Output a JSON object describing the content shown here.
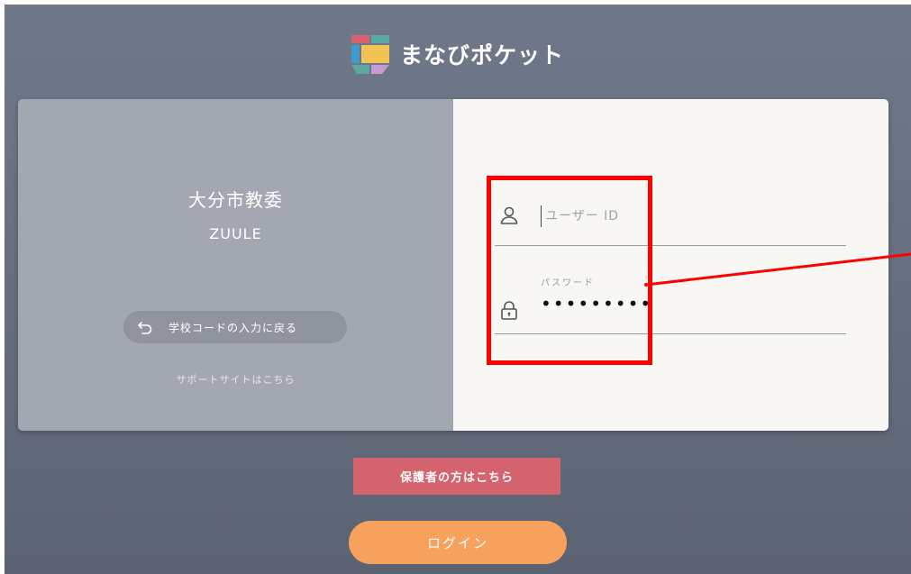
{
  "app": {
    "logo_text": "まなびポケット"
  },
  "school": {
    "name": "大分市教委",
    "sub_name": "ZUULE",
    "back_label": "学校コードの入力に戻る",
    "support_link": "サポートサイトはこちら"
  },
  "form": {
    "user_placeholder": "ユーザー ID",
    "user_value": "",
    "password_label": "パスワード",
    "password_value": "•••••••••"
  },
  "buttons": {
    "guardian_label": "保護者の方はこちら",
    "login_label": "ログイン"
  },
  "colors": {
    "background": "#666e7e",
    "card_left": "#a2a7b1",
    "card_right": "#f8f7f4",
    "guardian_button": "#d4636e",
    "login_button": "#f7a15c",
    "annotation": "#ff0000"
  },
  "icons": {
    "user": "user-icon",
    "lock": "lock-icon",
    "back": "undo-arrow-icon",
    "logo": "manabi-pocket-logo-icon"
  }
}
